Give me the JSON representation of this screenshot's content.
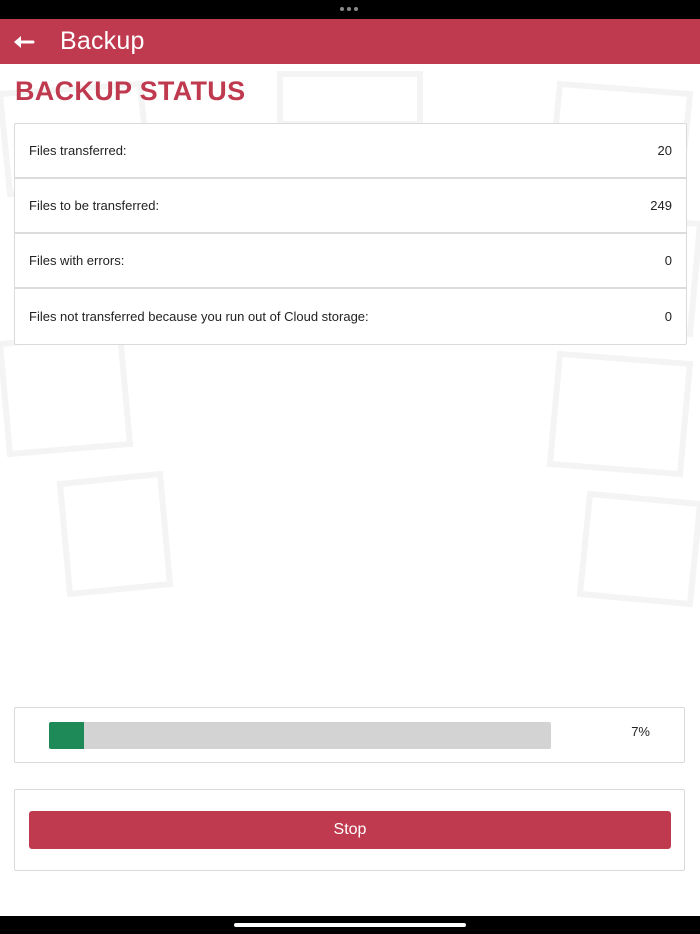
{
  "header": {
    "title": "Backup",
    "back_icon": "arrow-left-icon"
  },
  "section": {
    "title": "BACKUP STATUS"
  },
  "stats": [
    {
      "label": "Files transferred:",
      "value": "20"
    },
    {
      "label": "Files to be transferred:",
      "value": "249"
    },
    {
      "label": "Files with errors:",
      "value": "0"
    },
    {
      "label": "Files not transferred because you run out of Cloud storage:",
      "value": "0"
    }
  ],
  "progress": {
    "percent": 7,
    "label": "7%"
  },
  "actions": {
    "stop_label": "Stop"
  },
  "colors": {
    "brand": "#bf3a4f",
    "progress_fill": "#1e8a57",
    "progress_track": "#d3d3d3"
  }
}
